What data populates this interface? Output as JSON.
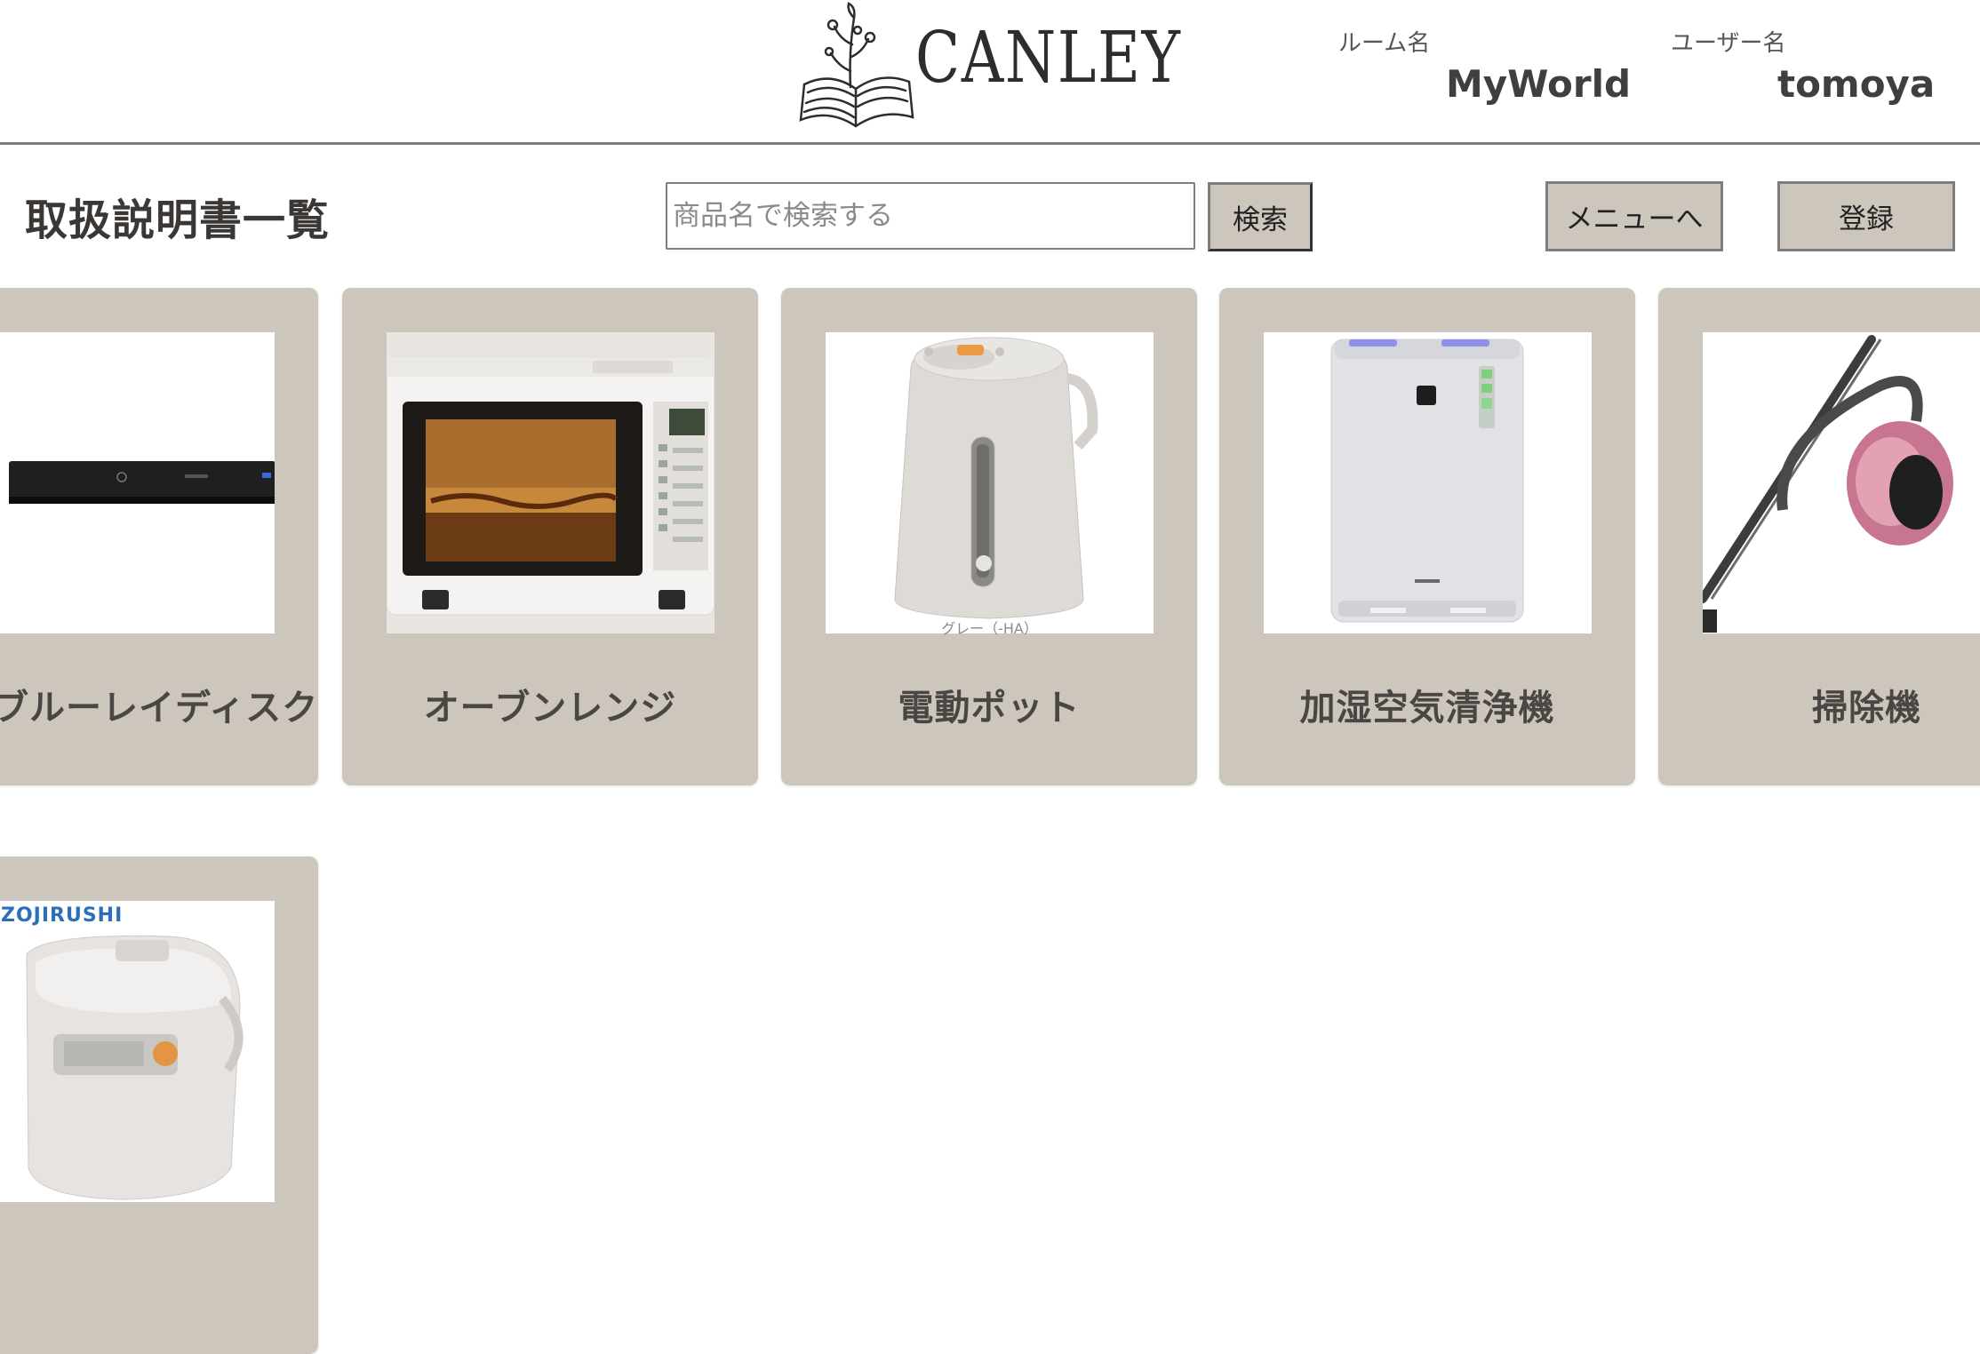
{
  "header": {
    "logo_text": "CANLEY",
    "room_label": "ルーム名",
    "room_value": "MyWorld",
    "user_label": "ユーザー名",
    "user_value": "tomoya"
  },
  "toolbar": {
    "page_title": "取扱説明書一覧",
    "search_placeholder": "商品名で検索する",
    "search_button": "検索",
    "menu_button": "メニューへ",
    "register_button": "登録"
  },
  "products": [
    {
      "name": "ブルーレイディスクレコーダー",
      "icon": "bluray-recorder-image"
    },
    {
      "name": "オーブンレンジ",
      "icon": "oven-range-image"
    },
    {
      "name": "電動ポット",
      "icon": "electric-pot-image",
      "image_caption": "グレー（-HA）"
    },
    {
      "name": "加湿空気清浄機",
      "icon": "air-purifier-image"
    },
    {
      "name": "掃除機",
      "icon": "vacuum-cleaner-image"
    },
    {
      "name": "",
      "icon": "rice-cooker-image",
      "image_caption": "ZOJIRUSHI"
    }
  ]
}
